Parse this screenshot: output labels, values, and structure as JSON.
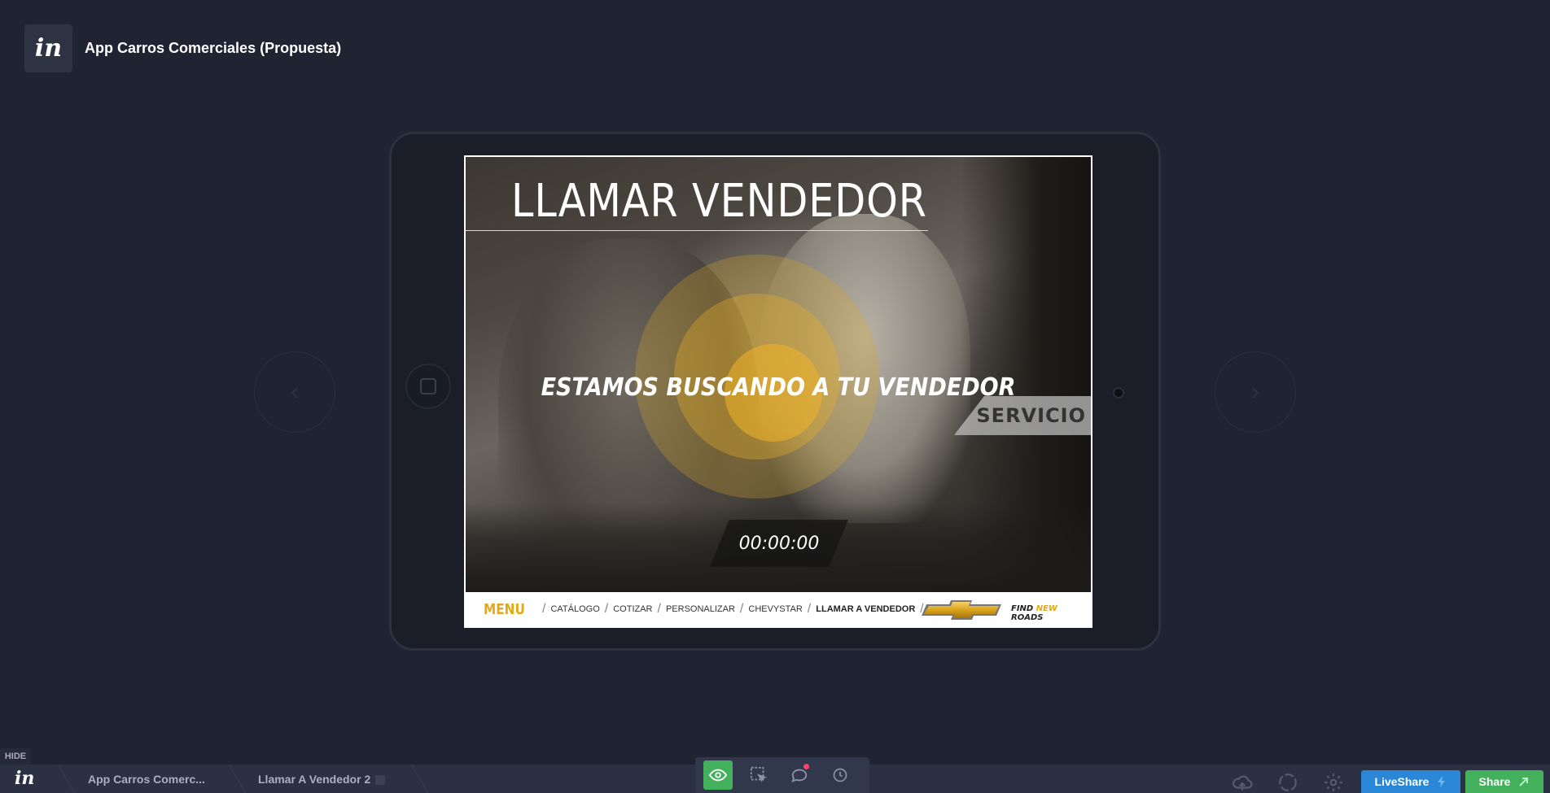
{
  "app": {
    "logo": "in",
    "project_title": "App Carros Comerciales (Propuesta)"
  },
  "icons": {
    "prev": "chevron-left-icon",
    "next": "chevron-right-icon",
    "arrow_prev": "‹",
    "arrow_next": "›"
  },
  "screen": {
    "title": "LLAMAR VENDEDOR",
    "status": "ESTAMOS BUSCANDO A TU VENDEDOR",
    "servicio_tag": "SERVICIO",
    "timer": "00:00:00",
    "accent_color": "#e4a817",
    "menu_label": "MENU",
    "menu_items": [
      "CATÁLOGO",
      "COTIZAR",
      "PERSONALIZAR",
      "CHEVYSTAR",
      "LLAMAR A VENDEDOR"
    ],
    "tagline": {
      "find": "FIND ",
      "new": "NEW",
      "roads": " ROADS"
    }
  },
  "toolbar": {
    "hide_label": "HIDE",
    "logo": "in",
    "breadcrumbs": [
      "App Carros Comerc...",
      "Llamar A Vendedor 2"
    ],
    "liveshare_label": "LiveShare",
    "share_label": "Share",
    "colors": {
      "liveshare": "#2a86d6",
      "share": "#43b05c",
      "active_mode": "#43b05c",
      "notification": "#ff4266"
    }
  }
}
